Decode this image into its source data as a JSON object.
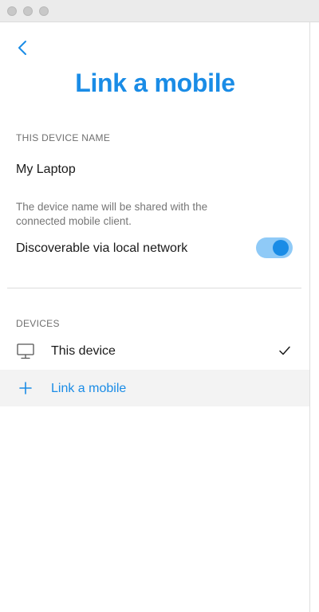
{
  "page": {
    "title": "Link a mobile",
    "back_icon": "chevron-left-icon"
  },
  "device_name_section": {
    "label": "THIS DEVICE NAME",
    "value": "My Laptop",
    "help": "The device name will be shared with the connected mobile client."
  },
  "discoverable": {
    "label": "Discoverable via local network",
    "enabled": true
  },
  "devices_section": {
    "label": "DEVICES",
    "items": [
      {
        "name": "This device",
        "icon": "monitor-icon",
        "selected": true
      }
    ],
    "link_action": {
      "label": "Link a mobile",
      "icon": "plus-icon"
    }
  },
  "colors": {
    "accent": "#1a8ce6",
    "toggle_track": "#8fcaf7",
    "row_highlight": "#f3f3f3"
  }
}
